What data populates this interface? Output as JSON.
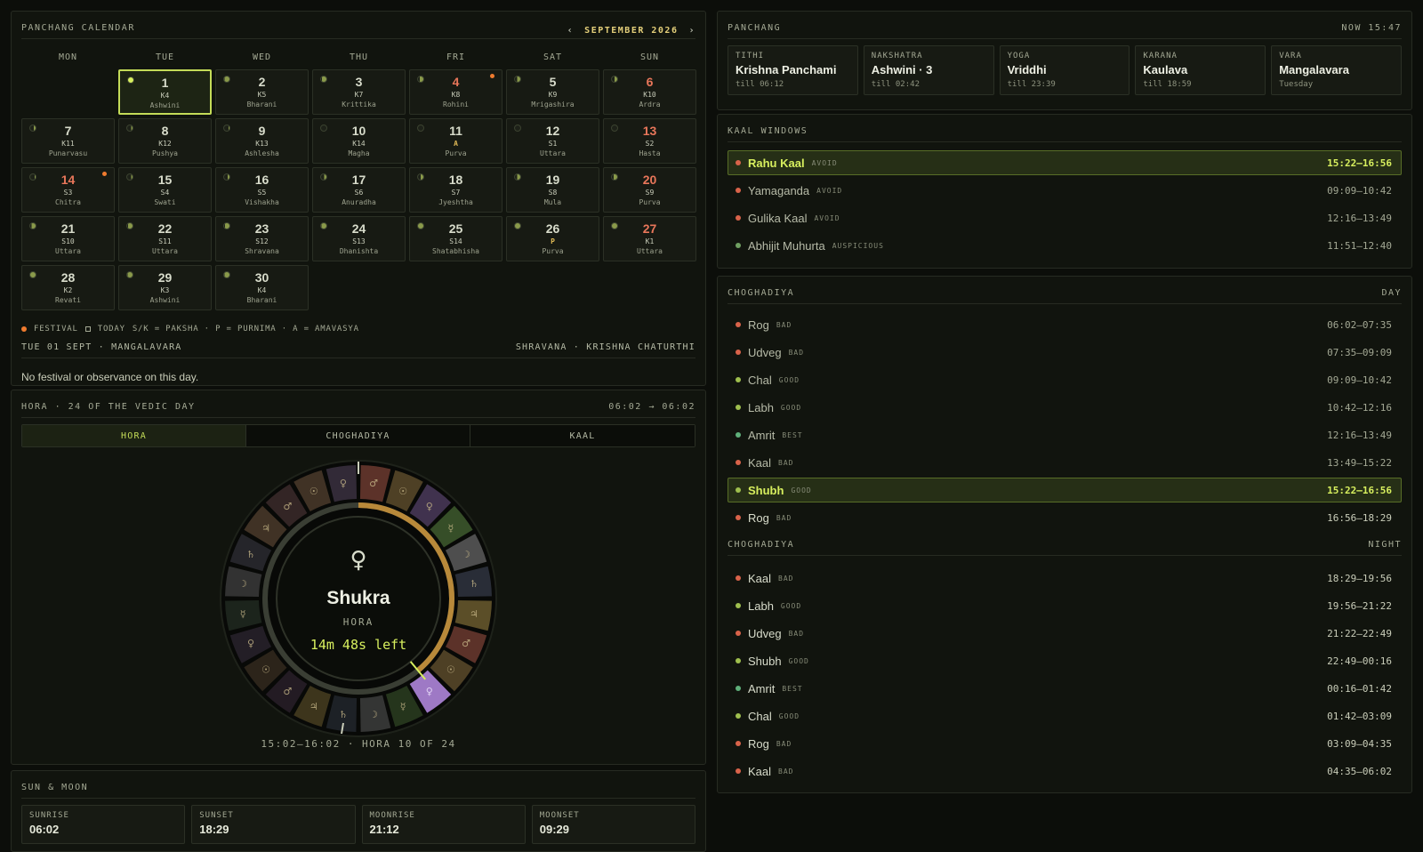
{
  "calendar": {
    "title": "PANCHANG CALENDAR",
    "month": "SEPTEMBER 2026",
    "prev": "‹",
    "next": "›",
    "weekdays": [
      "MON",
      "TUE",
      "WED",
      "THU",
      "FRI",
      "SAT",
      "SUN"
    ],
    "days": [
      {
        "d": "1",
        "t": "K4",
        "n": "Ashwini",
        "today": true,
        "moon": 1.0
      },
      {
        "d": "2",
        "t": "K5",
        "n": "Bharani",
        "moon": 0.9
      },
      {
        "d": "3",
        "t": "K7",
        "n": "Krittika",
        "moon": 0.8
      },
      {
        "d": "4",
        "t": "K8",
        "n": "Rohini",
        "red": true,
        "fest": true,
        "moon": 0.7
      },
      {
        "d": "5",
        "t": "K9",
        "n": "Mrigashira",
        "moon": 0.6
      },
      {
        "d": "6",
        "t": "K10",
        "n": "Ardra",
        "red": true,
        "moon": 0.5
      },
      {
        "d": "7",
        "t": "K11",
        "n": "Punarvasu",
        "moon": 0.35
      },
      {
        "d": "8",
        "t": "K12",
        "n": "Pushya",
        "moon": 0.25
      },
      {
        "d": "9",
        "t": "K13",
        "n": "Ashlesha",
        "moon": 0.15
      },
      {
        "d": "10",
        "t": "K14",
        "n": "Magha",
        "moon": 0.05
      },
      {
        "d": "11",
        "t": "A",
        "n": "Purva",
        "bold": true,
        "moon": 0.0
      },
      {
        "d": "12",
        "t": "S1",
        "n": "Uttara",
        "moon": 0.03
      },
      {
        "d": "13",
        "t": "S2",
        "n": "Hasta",
        "red": true,
        "moon": 0.08
      },
      {
        "d": "14",
        "t": "S3",
        "n": "Chitra",
        "red": true,
        "fest": true,
        "moon": 0.15
      },
      {
        "d": "15",
        "t": "S4",
        "n": "Swati",
        "moon": 0.22
      },
      {
        "d": "16",
        "t": "S5",
        "n": "Vishakha",
        "moon": 0.3
      },
      {
        "d": "17",
        "t": "S6",
        "n": "Anuradha",
        "moon": 0.4
      },
      {
        "d": "18",
        "t": "S7",
        "n": "Jyeshtha",
        "moon": 0.5
      },
      {
        "d": "19",
        "t": "S8",
        "n": "Mula",
        "moon": 0.6
      },
      {
        "d": "20",
        "t": "S9",
        "n": "Purva",
        "red": true,
        "moon": 0.65
      },
      {
        "d": "21",
        "t": "S10",
        "n": "Uttara",
        "moon": 0.72
      },
      {
        "d": "22",
        "t": "S11",
        "n": "Uttara",
        "moon": 0.8
      },
      {
        "d": "23",
        "t": "S12",
        "n": "Shravana",
        "moon": 0.85
      },
      {
        "d": "24",
        "t": "S13",
        "n": "Dhanishta",
        "moon": 0.92
      },
      {
        "d": "25",
        "t": "S14",
        "n": "Shatabhisha",
        "moon": 0.96
      },
      {
        "d": "26",
        "t": "P",
        "n": "Purva",
        "bold": true,
        "moon": 1.0
      },
      {
        "d": "27",
        "t": "K1",
        "n": "Uttara",
        "red": true,
        "moon": 0.98
      },
      {
        "d": "28",
        "t": "K2",
        "n": "Revati",
        "moon": 0.96
      },
      {
        "d": "29",
        "t": "K3",
        "n": "Ashwini",
        "moon": 0.93
      },
      {
        "d": "30",
        "t": "K4",
        "n": "Bharani",
        "moon": 0.9
      }
    ],
    "legend": {
      "festival": "FESTIVAL",
      "today": "TODAY",
      "rest": "S/K = PAKSHA · P = PURNIMA · A = AMAVASYA"
    },
    "selected_day": "TUE 01 SEPT · MANGALAVARA",
    "selected_info": "SHRAVANA · KRISHNA CHATURTHI",
    "day_note": "No festival or observance on this day."
  },
  "hora": {
    "title": "HORA · 24 OF THE VEDIC DAY",
    "range": "06:02 → 06:02",
    "tabs": [
      "HORA",
      "CHOGHADIYA",
      "KAAL"
    ],
    "active_tab": 0,
    "planet_symbol": "♀",
    "planet": "Shukra",
    "label": "HORA",
    "remaining": "14m 48s left",
    "footer": "15:02–16:02 · HORA 10 OF 24",
    "elapsed_fraction": 0.39
  },
  "sun_moon": {
    "title": "SUN & MOON",
    "items": [
      {
        "label": "SUNRISE",
        "value": "06:02"
      },
      {
        "label": "SUNSET",
        "value": "18:29"
      },
      {
        "label": "MOONRISE",
        "value": "21:12"
      },
      {
        "label": "MOONSET",
        "value": "09:29"
      }
    ]
  },
  "panchang": {
    "title": "PANCHANG",
    "now": "NOW 15:47",
    "items": [
      {
        "label": "TITHI",
        "value": "Krishna Panchami",
        "sub": "till 06:12"
      },
      {
        "label": "NAKSHATRA",
        "value": "Ashwini · 3",
        "sub": "till 02:42"
      },
      {
        "label": "YOGA",
        "value": "Vriddhi",
        "sub": "till 23:39"
      },
      {
        "label": "KARANA",
        "value": "Kaulava",
        "sub": "till 18:59"
      },
      {
        "label": "VARA",
        "value": "Mangalavara",
        "sub": "Tuesday"
      }
    ]
  },
  "kaal": {
    "title": "KAAL WINDOWS",
    "rows": [
      {
        "name": "Rahu Kaal",
        "tag": "AVOID",
        "time": "15:22–16:56",
        "color": "#d9634a",
        "active": true
      },
      {
        "name": "Yamaganda",
        "tag": "AVOID",
        "time": "09:09–10:42",
        "color": "#d9634a",
        "dim": true
      },
      {
        "name": "Gulika Kaal",
        "tag": "AVOID",
        "time": "12:16–13:49",
        "color": "#d9634a",
        "dim": true
      },
      {
        "name": "Abhijit Muhurta",
        "tag": "AUSPICIOUS",
        "time": "11:51–12:40",
        "color": "#6fa061",
        "dim": true
      }
    ]
  },
  "chog_day": {
    "title": "CHOGHADIYA",
    "period": "DAY",
    "rows": [
      {
        "name": "Rog",
        "tag": "BAD",
        "time": "06:02–07:35",
        "color": "#d9634a",
        "dim": true
      },
      {
        "name": "Udveg",
        "tag": "BAD",
        "time": "07:35–09:09",
        "color": "#d9634a",
        "dim": true
      },
      {
        "name": "Chal",
        "tag": "GOOD",
        "time": "09:09–10:42",
        "color": "#9fbf4e",
        "dim": true
      },
      {
        "name": "Labh",
        "tag": "GOOD",
        "time": "10:42–12:16",
        "color": "#9fbf4e",
        "dim": true
      },
      {
        "name": "Amrit",
        "tag": "BEST",
        "time": "12:16–13:49",
        "color": "#5fb07a",
        "dim": true
      },
      {
        "name": "Kaal",
        "tag": "BAD",
        "time": "13:49–15:22",
        "color": "#d9634a",
        "dim": true
      },
      {
        "name": "Shubh",
        "tag": "GOOD",
        "time": "15:22–16:56",
        "color": "#9fbf4e",
        "active": true
      },
      {
        "name": "Rog",
        "tag": "BAD",
        "time": "16:56–18:29",
        "color": "#d9634a"
      }
    ]
  },
  "chog_night": {
    "title": "CHOGHADIYA",
    "period": "NIGHT",
    "rows": [
      {
        "name": "Kaal",
        "tag": "BAD",
        "time": "18:29–19:56",
        "color": "#d9634a"
      },
      {
        "name": "Labh",
        "tag": "GOOD",
        "time": "19:56–21:22",
        "color": "#9fbf4e"
      },
      {
        "name": "Udveg",
        "tag": "BAD",
        "time": "21:22–22:49",
        "color": "#d9634a"
      },
      {
        "name": "Shubh",
        "tag": "GOOD",
        "time": "22:49–00:16",
        "color": "#9fbf4e"
      },
      {
        "name": "Amrit",
        "tag": "BEST",
        "time": "00:16–01:42",
        "color": "#5fb07a"
      },
      {
        "name": "Chal",
        "tag": "GOOD",
        "time": "01:42–03:09",
        "color": "#9fbf4e"
      },
      {
        "name": "Rog",
        "tag": "BAD",
        "time": "03:09–04:35",
        "color": "#d9634a"
      },
      {
        "name": "Kaal",
        "tag": "BAD",
        "time": "04:35–06:02",
        "color": "#d9634a"
      }
    ]
  }
}
